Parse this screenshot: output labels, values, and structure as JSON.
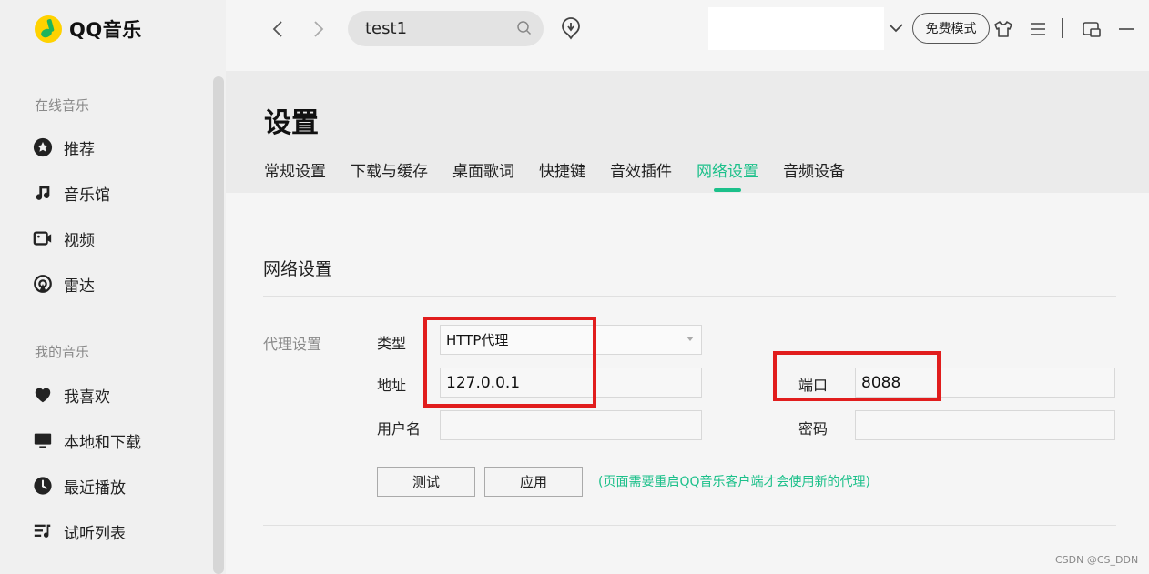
{
  "app": {
    "logo_text": "QQ音乐"
  },
  "sidebar": {
    "online_title": "在线音乐",
    "online_items": [
      {
        "label": "推荐",
        "icon": "star-icon"
      },
      {
        "label": "音乐馆",
        "icon": "music-note-icon"
      },
      {
        "label": "视频",
        "icon": "video-icon"
      },
      {
        "label": "雷达",
        "icon": "radar-icon"
      }
    ],
    "my_title": "我的音乐",
    "my_items": [
      {
        "label": "我喜欢",
        "icon": "heart-icon"
      },
      {
        "label": "本地和下载",
        "icon": "monitor-icon"
      },
      {
        "label": "最近播放",
        "icon": "clock-icon"
      },
      {
        "label": "试听列表",
        "icon": "playlist-icon"
      }
    ]
  },
  "topbar": {
    "search_value": "test1",
    "free_mode": "免费模式"
  },
  "settings": {
    "title": "设置",
    "tabs": [
      "常规设置",
      "下载与缓存",
      "桌面歌词",
      "快捷键",
      "音效插件",
      "网络设置",
      "音频设备"
    ],
    "active_tab": "网络设置",
    "section": "网络设置",
    "proxy_label": "代理设置",
    "type_label": "类型",
    "type_value": "HTTP代理",
    "address_label": "地址",
    "address_value": "127.0.0.1",
    "port_label": "端口",
    "port_value": "8088",
    "username_label": "用户名",
    "username_value": "",
    "password_label": "密码",
    "password_value": "",
    "test_button": "测试",
    "apply_button": "应用",
    "hint": "(页面需要重启QQ音乐客户端才会使用新的代理)"
  },
  "watermark": "CSDN @CS_DDN",
  "colors": {
    "accent": "#1cc08a",
    "highlight": "#e11d1d"
  }
}
